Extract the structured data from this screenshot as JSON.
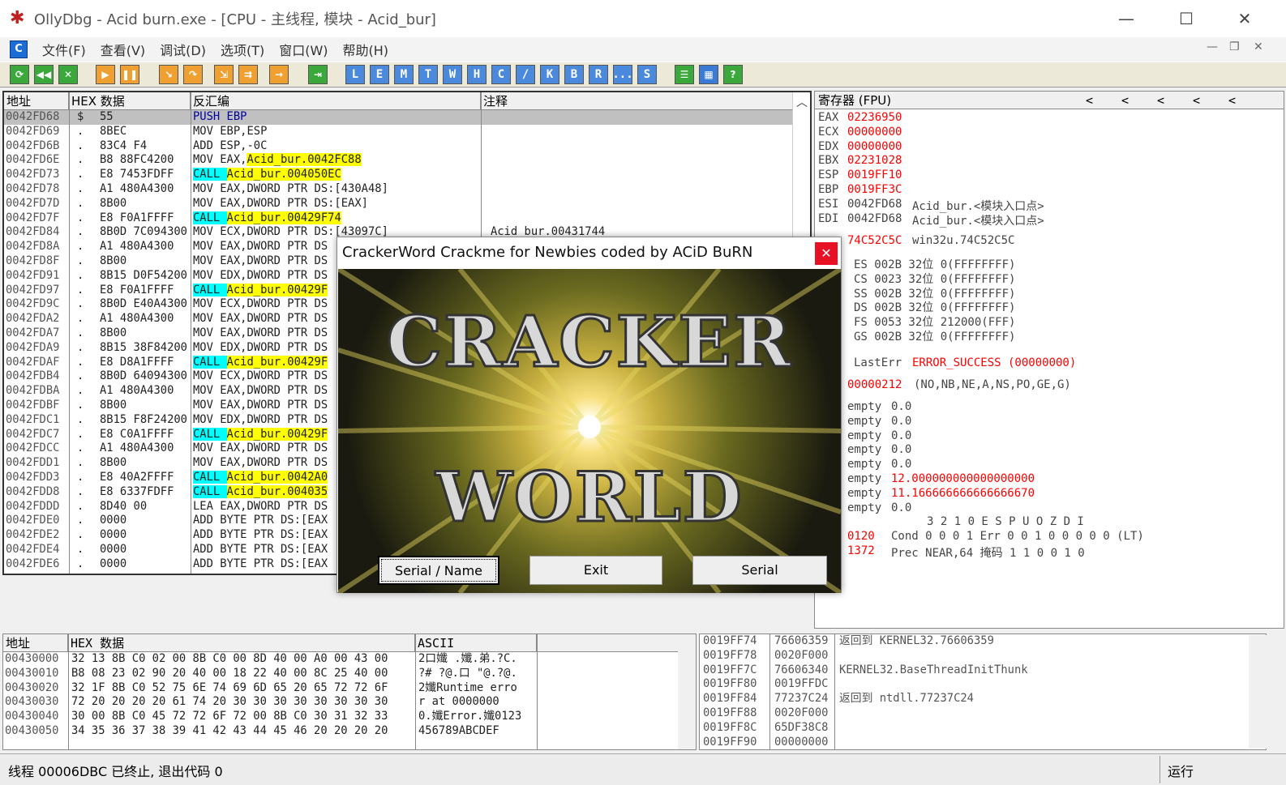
{
  "window": {
    "title": "OllyDbg - Acid burn.exe - [CPU - 主线程, 模块 - Acid_bur]",
    "min": "—",
    "max": "☐",
    "close": "✕"
  },
  "menu": [
    "文件(F)",
    "查看(V)",
    "调试(D)",
    "选项(T)",
    "窗口(W)",
    "帮助(H)"
  ],
  "toolbar": {
    "letters": [
      "L",
      "E",
      "M",
      "T",
      "W",
      "H",
      "C",
      "/",
      "K",
      "B",
      "R",
      "...",
      "S"
    ]
  },
  "cpu": {
    "headers": [
      "地址",
      "HEX 数据",
      "反汇编",
      "注释"
    ],
    "rows": [
      [
        "0042FD68",
        "$",
        "55",
        "PUSH EBP",
        ""
      ],
      [
        "0042FD69",
        ".",
        "8BEC",
        "MOV EBP,ESP",
        ""
      ],
      [
        "0042FD6B",
        ".",
        "83C4 F4",
        "ADD ESP,-0C",
        ""
      ],
      [
        "0042FD6E",
        ".",
        "B8 88FC4200",
        "MOV EAX,Acid_bur.0042FC88",
        ""
      ],
      [
        "0042FD73",
        ".",
        "E8 7453FDFF",
        "CALL Acid_bur.004050EC",
        ""
      ],
      [
        "0042FD78",
        ".",
        "A1 480A4300",
        "MOV EAX,DWORD PTR DS:[430A48]",
        ""
      ],
      [
        "0042FD7D",
        ".",
        "8B00",
        "MOV EAX,DWORD PTR DS:[EAX]",
        ""
      ],
      [
        "0042FD7F",
        ".",
        "E8 F0A1FFFF",
        "CALL Acid_bur.00429F74",
        ""
      ],
      [
        "0042FD84",
        ".",
        "8B0D 7C094300",
        "MOV ECX,DWORD PTR DS:[43097C]",
        "Acid_bur.00431744"
      ],
      [
        "0042FD8A",
        ".",
        "A1 480A4300",
        "MOV EAX,DWORD PTR DS",
        ""
      ],
      [
        "0042FD8F",
        ".",
        "8B00",
        "MOV EAX,DWORD PTR DS",
        ""
      ],
      [
        "0042FD91",
        ".",
        "8B15 D0F54200",
        "MOV EDX,DWORD PTR DS",
        ""
      ],
      [
        "0042FD97",
        ".",
        "E8 F0A1FFFF",
        "CALL Acid_bur.00429F",
        ""
      ],
      [
        "0042FD9C",
        ".",
        "8B0D E40A4300",
        "MOV ECX,DWORD PTR DS",
        ""
      ],
      [
        "0042FDA2",
        ".",
        "A1 480A4300",
        "MOV EAX,DWORD PTR DS",
        ""
      ],
      [
        "0042FDA7",
        ".",
        "8B00",
        "MOV EAX,DWORD PTR DS",
        ""
      ],
      [
        "0042FDA9",
        ".",
        "8B15 38F84200",
        "MOV EDX,DWORD PTR DS",
        ""
      ],
      [
        "0042FDAF",
        ".",
        "E8 D8A1FFFF",
        "CALL Acid_bur.00429F",
        ""
      ],
      [
        "0042FDB4",
        ".",
        "8B0D 64094300",
        "MOV ECX,DWORD PTR DS",
        ""
      ],
      [
        "0042FDBA",
        ".",
        "A1 480A4300",
        "MOV EAX,DWORD PTR DS",
        ""
      ],
      [
        "0042FDBF",
        ".",
        "8B00",
        "MOV EAX,DWORD PTR DS",
        ""
      ],
      [
        "0042FDC1",
        ".",
        "8B15 F8F24200",
        "MOV EDX,DWORD PTR DS",
        ""
      ],
      [
        "0042FDC7",
        ".",
        "E8 C0A1FFFF",
        "CALL Acid_bur.00429F",
        ""
      ],
      [
        "0042FDCC",
        ".",
        "A1 480A4300",
        "MOV EAX,DWORD PTR DS",
        ""
      ],
      [
        "0042FDD1",
        ".",
        "8B00",
        "MOV EAX,DWORD PTR DS",
        ""
      ],
      [
        "0042FDD3",
        ".",
        "E8 40A2FFFF",
        "CALL Acid_bur.0042A0",
        ""
      ],
      [
        "0042FDD8",
        ".",
        "E8 6337FDFF",
        "CALL Acid_bur.004035",
        ""
      ],
      [
        "0042FDDD",
        ".",
        "8D40 00",
        "LEA EAX,DWORD PTR DS",
        ""
      ],
      [
        "0042FDE0",
        ".",
        "0000",
        "ADD BYTE PTR DS:[EAX",
        ""
      ],
      [
        "0042FDE2",
        ".",
        "0000",
        "ADD BYTE PTR DS:[EAX",
        ""
      ],
      [
        "0042FDE4",
        ".",
        "0000",
        "ADD BYTE PTR DS:[EAX",
        ""
      ],
      [
        "0042FDE6",
        ".",
        "0000",
        "ADD BYTE PTR DS:[EAX",
        ""
      ]
    ]
  },
  "registers": {
    "header": "寄存器 (FPU)",
    "arrows": [
      "<",
      "<",
      "<",
      "<",
      "<"
    ],
    "gp": [
      [
        "EAX",
        "02236950",
        ""
      ],
      [
        "ECX",
        "00000000",
        ""
      ],
      [
        "EDX",
        "00000000",
        ""
      ],
      [
        "EBX",
        "02231028",
        ""
      ],
      [
        "ESP",
        "0019FF10",
        ""
      ],
      [
        "EBP",
        "0019FF3C",
        ""
      ],
      [
        "ESI",
        "0042FD68",
        "Acid_bur.<模块入口点>"
      ],
      [
        "EDI",
        "0042FD68",
        "Acid_bur.<模块入口点>"
      ]
    ],
    "eip": [
      "74C52C5C",
      "win32u.74C52C5C"
    ],
    "seg": [
      "ES 002B 32位 0(FFFFFFFF)",
      "CS 0023 32位 0(FFFFFFFF)",
      "SS 002B 32位 0(FFFFFFFF)",
      "DS 002B 32位 0(FFFFFFFF)",
      "FS 0053 32位 212000(FFF)",
      "GS 002B 32位 0(FFFFFFFF)"
    ],
    "lasterr": [
      "LastErr",
      "ERROR_SUCCESS (00000000)"
    ],
    "eflags": [
      "00000212",
      "(NO,NB,NE,A,NS,PO,GE,G)"
    ],
    "fpu": [
      [
        "empty",
        "0.0",
        false
      ],
      [
        "empty",
        "0.0",
        false
      ],
      [
        "empty",
        "0.0",
        false
      ],
      [
        "empty",
        "0.0",
        false
      ],
      [
        "empty",
        "0.0",
        false
      ],
      [
        "empty",
        "12.000000000000000000",
        true
      ],
      [
        "empty",
        "11.166666666666666670",
        true
      ],
      [
        "empty",
        "0.0",
        false
      ]
    ],
    "fpu_bits_hdr": "3 2 1 0      E S P U O Z D I",
    "cond": [
      "0120",
      "Cond 0 0 0 1  Err 0 0 1 0 0 0 0 0  (LT)"
    ],
    "prec": [
      "1372",
      "Prec NEAR,64  掩码    1 1 0 0 1 0"
    ]
  },
  "dump": {
    "headers": [
      "地址",
      "HEX 数据",
      "ASCII"
    ],
    "rows": [
      [
        "00430000",
        "32 13 8B C0 02 00 8B C0 00 8D 40 00 A0 00 43 00",
        "2口孅 .孅.弟.?C."
      ],
      [
        "00430010",
        "B8 08 23 02 90 20 40 00 18 22 40 00 8C 25 40 00",
        "?# ?@.口 \"@.?@."
      ],
      [
        "00430020",
        "32 1F 8B C0 52 75 6E 74 69 6D 65 20 65 72 72 6F",
        "2孅Runtime erro"
      ],
      [
        "00430030",
        "72 20 20 20 20 61 74 20 30 30 30 30 30 30 30 30",
        "r    at 0000000"
      ],
      [
        "00430040",
        "30 00 8B C0 45 72 72 6F 72 00 8B C0 30 31 32 33",
        "0.孅Error.孅0123"
      ],
      [
        "00430050",
        "34 35 36 37 38 39 41 42 43 44 45 46 20 20 20 20",
        "456789ABCDEF"
      ]
    ]
  },
  "stack": {
    "rows": [
      [
        "0019FF74",
        "76606359",
        "返回到 KERNEL32.76606359"
      ],
      [
        "0019FF78",
        "0020F000",
        ""
      ],
      [
        "0019FF7C",
        "76606340",
        "KERNEL32.BaseThreadInitThunk"
      ],
      [
        "0019FF80",
        "0019FFDC",
        ""
      ],
      [
        "0019FF84",
        "77237C24",
        "返回到 ntdll.77237C24"
      ],
      [
        "0019FF88",
        "0020F000",
        ""
      ],
      [
        "0019FF8C",
        "65DF38C8",
        ""
      ],
      [
        "0019FF90",
        "00000000",
        ""
      ]
    ]
  },
  "status": {
    "text": "线程 00006DBC 已终止, 退出代码 0",
    "state": "运行"
  },
  "dialog": {
    "title": "CrackerWord Crackme for Newbies coded by ACiD BuRN",
    "close": "✕",
    "art_line1": "CRACKER",
    "art_line2": "WORLD",
    "buttons": [
      "Serial / Name",
      "Exit",
      "Serial"
    ]
  },
  "colors": {
    "call_bg": "#00ffff",
    "symbol_bg": "#ffff00",
    "reg_changed": "#ff0000"
  }
}
